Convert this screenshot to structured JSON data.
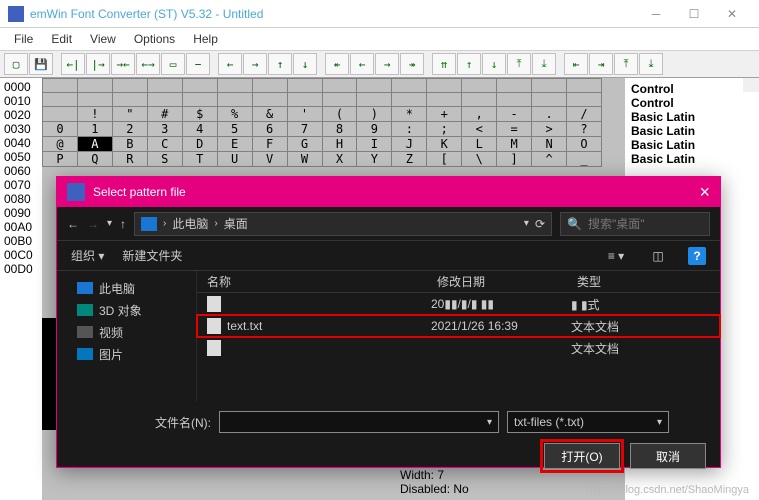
{
  "window": {
    "title": "emWin Font Converter (ST) V5.32 - Untitled"
  },
  "menu": {
    "file": "File",
    "edit": "Edit",
    "view": "View",
    "options": "Options",
    "help": "Help"
  },
  "codes": [
    "0000",
    "0010",
    "0020",
    "0030",
    "0040",
    "0050",
    "0060",
    "0070",
    "0080",
    "0090",
    "00A0",
    "00B0",
    "00C0",
    "00D0"
  ],
  "right_names": [
    "Control",
    "Control",
    "Basic Latin",
    "Basic Latin",
    "Basic Latin",
    "Basic Latin"
  ],
  "grid": {
    "rows": [
      [
        "",
        "",
        "",
        "",
        "",
        "",
        "",
        "",
        "",
        "",
        "",
        "",
        "",
        "",
        "",
        ""
      ],
      [
        "",
        "",
        "",
        "",
        "",
        "",
        "",
        "",
        "",
        "",
        "",
        "",
        "",
        "",
        "",
        ""
      ],
      [
        "",
        "!",
        "\"",
        "#",
        "$",
        "%",
        "&",
        "'",
        "(",
        ")",
        "*",
        "+",
        ",",
        "-",
        ".",
        "/"
      ],
      [
        "0",
        "1",
        "2",
        "3",
        "4",
        "5",
        "6",
        "7",
        "8",
        "9",
        ":",
        ";",
        "<",
        "=",
        ">",
        "?"
      ],
      [
        "@",
        "A",
        "B",
        "C",
        "D",
        "E",
        "F",
        "G",
        "H",
        "I",
        "J",
        "K",
        "L",
        "M",
        "N",
        "O"
      ],
      [
        "P",
        "Q",
        "R",
        "S",
        "T",
        "U",
        "V",
        "W",
        "X",
        "Y",
        "Z",
        "[",
        "\\",
        "]",
        "^",
        "_"
      ]
    ],
    "highlight_row": 4,
    "highlight_col": 1
  },
  "dialog": {
    "title": "Select pattern file",
    "close": "×",
    "breadcrumb": {
      "pc": "此电脑",
      "sep": "›",
      "loc": "桌面"
    },
    "search_placeholder": "搜索\"桌面\"",
    "organize": "组织 ▾",
    "newfolder": "新建文件夹",
    "tree": {
      "pc": "此电脑",
      "threed": "3D 对象",
      "video": "视频",
      "pic": "图片"
    },
    "columns": {
      "name": "名称",
      "date": "修改日期",
      "type": "类型"
    },
    "files": [
      {
        "name": "",
        "date": "20▮▮/▮/▮ ▮▮",
        "type": "▮ ▮式"
      },
      {
        "name": "text.txt",
        "date": "2021/1/26 16:39",
        "type": "文本文档"
      },
      {
        "name": "",
        "date": "",
        "type": "文本文档"
      }
    ],
    "filename_label": "文件名(N):",
    "filename_value": "",
    "filter": "txt-files (*.txt)",
    "open": "打开(O)",
    "cancel": "取消"
  },
  "status": {
    "width": "Width:     7",
    "disabled": "Disabled:  No"
  },
  "watermark": "https://blog.csdn.net/ShaoMingya"
}
